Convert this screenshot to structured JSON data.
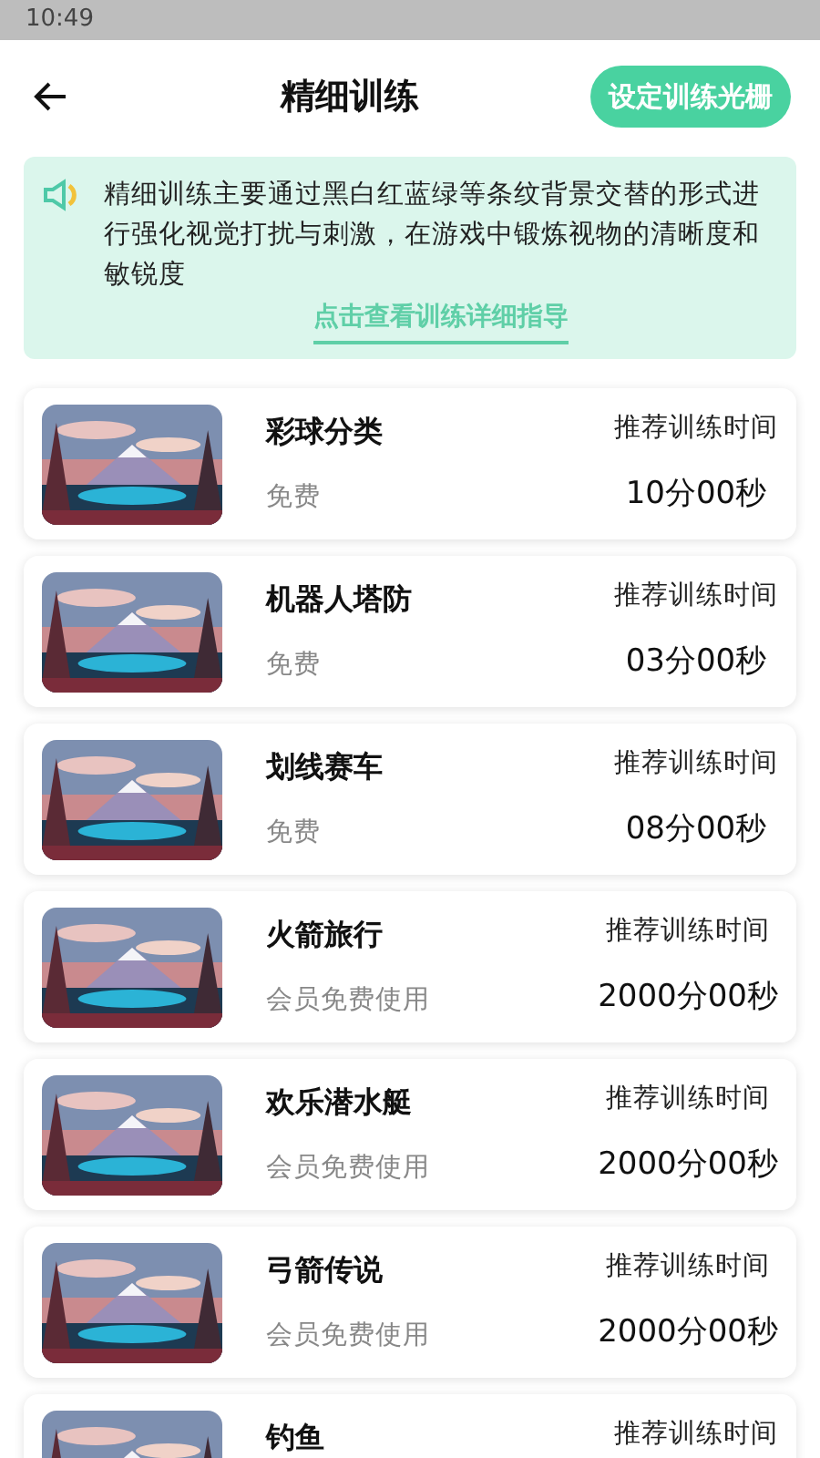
{
  "status_bar": {
    "time": "10:49"
  },
  "header": {
    "title": "精细训练",
    "action_button": "设定训练光栅"
  },
  "notice": {
    "text": "精细训练主要通过黑白红蓝绿等条纹背景交替的形式进行强化视觉打扰与刺激，在游戏中锻炼视物的清晰度和敏锐度",
    "link": "点击查看训练详细指导"
  },
  "games": [
    {
      "title": "彩球分类",
      "price": "免费",
      "time_label": "推荐训练时间",
      "time": "10分00秒"
    },
    {
      "title": "机器人塔防",
      "price": "免费",
      "time_label": "推荐训练时间",
      "time": "03分00秒"
    },
    {
      "title": "划线赛车",
      "price": "免费",
      "time_label": "推荐训练时间",
      "time": "08分00秒"
    },
    {
      "title": "火箭旅行",
      "price": "会员免费使用",
      "time_label": "推荐训练时间",
      "time": "2000分00秒"
    },
    {
      "title": "欢乐潜水艇",
      "price": "会员免费使用",
      "time_label": "推荐训练时间",
      "time": "2000分00秒"
    },
    {
      "title": "弓箭传说",
      "price": "会员免费使用",
      "time_label": "推荐训练时间",
      "time": "2000分00秒"
    },
    {
      "title": "钓鱼",
      "time_label": "推荐训练时间"
    }
  ]
}
